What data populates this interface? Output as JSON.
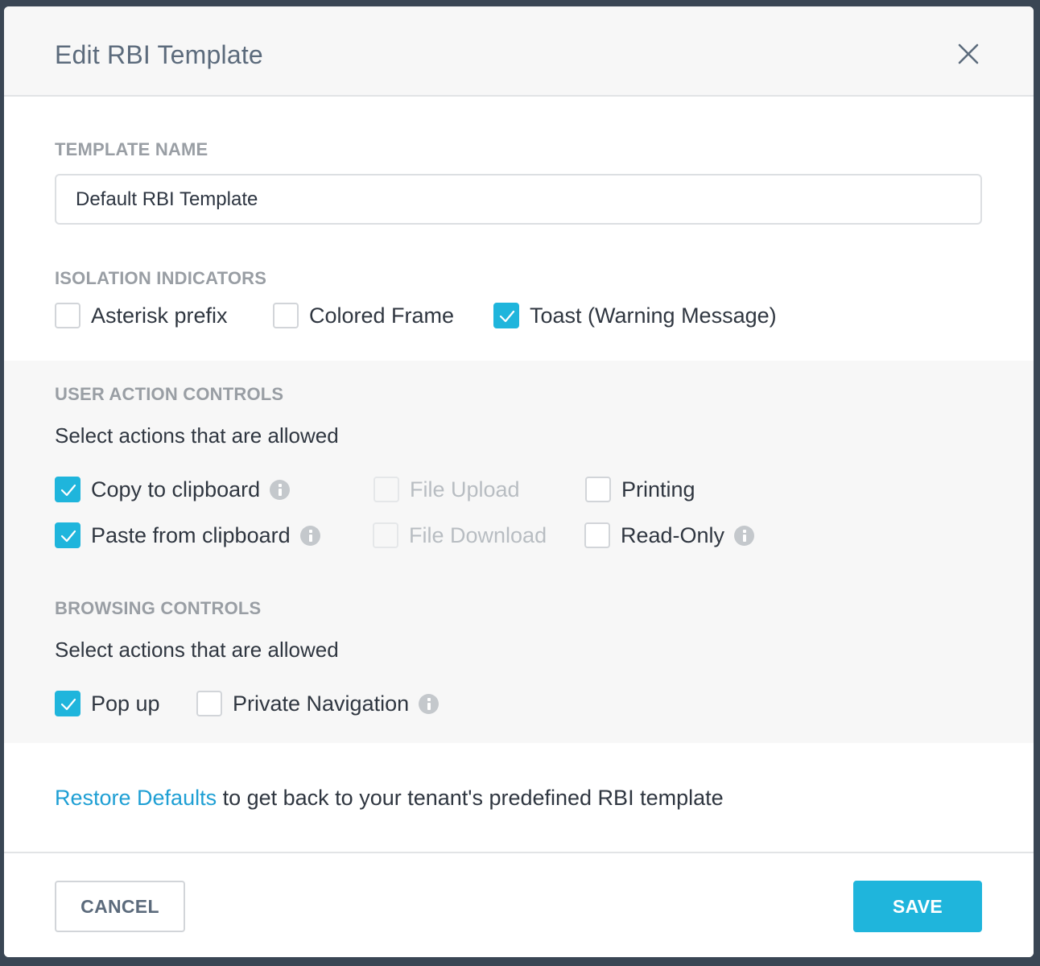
{
  "dialog": {
    "title": "Edit RBI Template"
  },
  "template_name": {
    "label": "TEMPLATE NAME",
    "value": "Default RBI Template"
  },
  "isolation_indicators": {
    "label": "ISOLATION INDICATORS",
    "items": [
      {
        "label": "Asterisk prefix",
        "checked": false
      },
      {
        "label": "Colored Frame",
        "checked": false
      },
      {
        "label": "Toast (Warning Message)",
        "checked": true
      }
    ]
  },
  "user_action_controls": {
    "label": "USER ACTION CONTROLS",
    "helper": "Select actions that are allowed",
    "items": [
      {
        "label": "Copy to clipboard",
        "checked": true,
        "disabled": false,
        "info": true
      },
      {
        "label": "Paste from clipboard",
        "checked": true,
        "disabled": false,
        "info": true
      },
      {
        "label": "File Upload",
        "checked": false,
        "disabled": true,
        "info": false
      },
      {
        "label": "File Download",
        "checked": false,
        "disabled": true,
        "info": false
      },
      {
        "label": "Printing",
        "checked": false,
        "disabled": false,
        "info": false
      },
      {
        "label": "Read-Only",
        "checked": false,
        "disabled": false,
        "info": true
      }
    ]
  },
  "browsing_controls": {
    "label": "BROWSING CONTROLS",
    "helper": "Select actions that are allowed",
    "items": [
      {
        "label": "Pop up",
        "checked": true,
        "info": false
      },
      {
        "label": "Private Navigation",
        "checked": false,
        "info": true
      }
    ]
  },
  "restore": {
    "link": "Restore Defaults",
    "text": " to get back to your tenant's predefined RBI template"
  },
  "footer": {
    "cancel_label": "CANCEL",
    "save_label": "SAVE"
  },
  "icons": {
    "close": "close-icon",
    "info": "info-icon",
    "checkmark": "checkmark-icon"
  },
  "colors": {
    "accent": "#1fb5dc",
    "link": "#1e9fd4",
    "title": "#5c6b7c",
    "section_label": "#999ea4",
    "disabled_text": "#b8bdc2"
  }
}
